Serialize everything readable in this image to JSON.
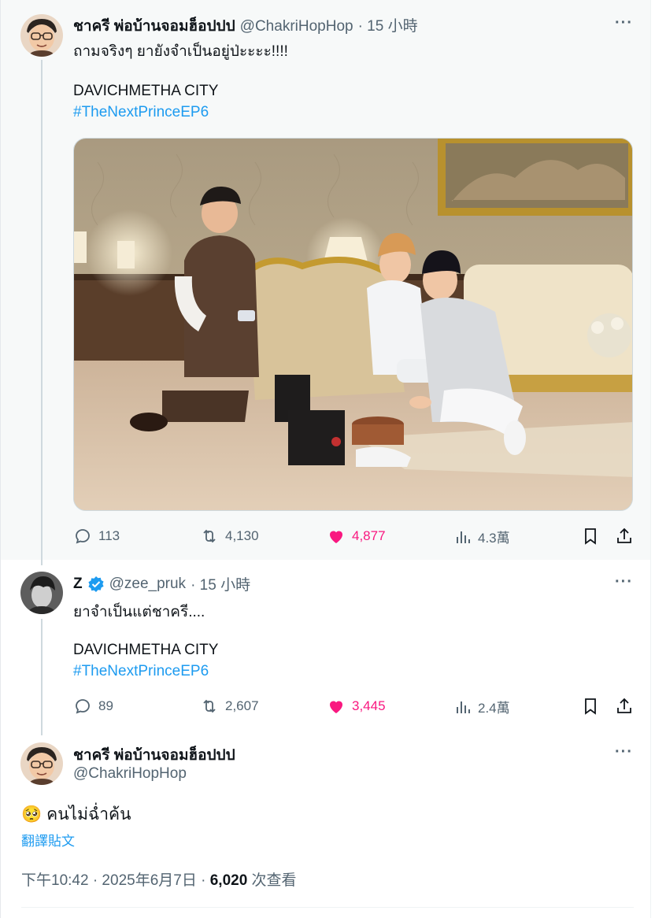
{
  "tweet1": {
    "display_name": "ชาครี พ่อบ้านจอมฮ็อปปป",
    "handle": "@ChakriHopHop",
    "time": "· 15 小時",
    "line1": "ถามจริงๆ ยายังจำเป็นอยู่ป่ะะะะ!!!!",
    "line2": "DAVICHMETHA CITY",
    "hashtag": "#TheNextPrinceEP6",
    "replies": "113",
    "retweets": "4,130",
    "likes": "4,877",
    "views": "4.3萬"
  },
  "tweet2": {
    "display_name": "Z",
    "handle": "@zee_pruk",
    "time": "· 15 小時",
    "line1": "ยาจำเป็นแต่ชาครี....",
    "line2": "DAVICHMETHA CITY",
    "hashtag": "#TheNextPrinceEP6",
    "replies": "89",
    "retweets": "2,607",
    "likes": "3,445",
    "views": "2.4萬"
  },
  "tweet3": {
    "display_name": "ชาครี พ่อบ้านจอมฮ็อปปป",
    "handle": "@ChakriHopHop",
    "emoji": "🥺",
    "text": "คนไม่ฉ่ำค้น",
    "translate": "翻譯貼文",
    "timestamp": "下午10:42 · 2025年6月7日 · ",
    "view_count": "6,020",
    "view_label": " 次查看"
  },
  "more_label": "···",
  "colors": {
    "accent": "#1d9bf0",
    "like": "#f91880",
    "muted": "#536471",
    "verified": "#1d9bf0"
  }
}
